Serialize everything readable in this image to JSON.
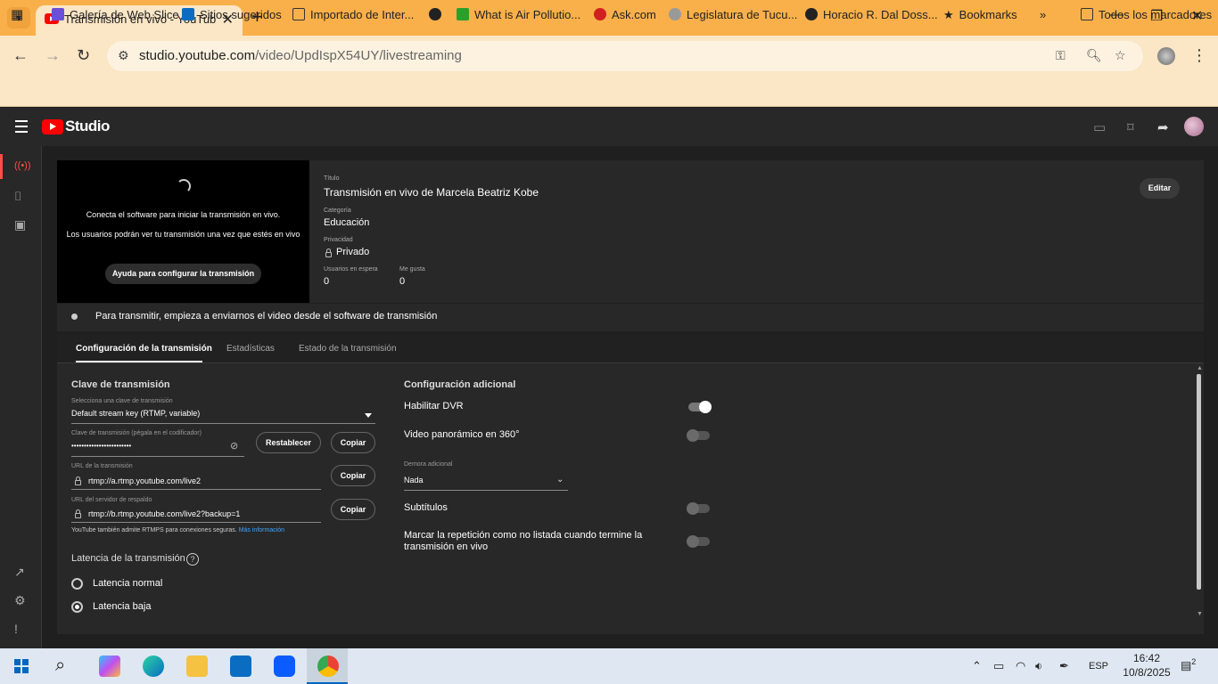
{
  "browser": {
    "tab_title": "Transmisión en vivo - YouTube Studio",
    "url_host": "studio.youtube.com",
    "url_path": "/video/UpdIspX54UY/livestreaming",
    "bookmarks": [
      "Galería de Web Slice",
      "Sitios sugeridos",
      "Importado de Inter...",
      "What is Air Pollutio...",
      "Ask.com",
      "Legislatura de Tucu...",
      "Horacio R. Dal Doss...",
      "Bookmarks",
      "Todos los marcadores"
    ]
  },
  "studio": {
    "logo_text": "Studio"
  },
  "preview": {
    "line1": "Conecta el software para iniciar la transmisión en vivo.",
    "line2": "Los usuarios podrán ver tu transmisión una vez que estés en vivo",
    "help_button": "Ayuda para configurar la transmisión"
  },
  "details": {
    "title_label": "Título",
    "title_value": "Transmisión en vivo de Marcela Beatriz Kobe",
    "category_label": "Categoría",
    "category_value": "Educación",
    "privacy_label": "Privacidad",
    "privacy_value": "Privado",
    "waiting_label": "Usuarios en espera",
    "waiting_value": "0",
    "likes_label": "Me gusta",
    "likes_value": "0",
    "edit_button": "Editar"
  },
  "status_text": "Para transmitir, empieza a enviarnos el video desde el software de transmisión",
  "tabs": [
    "Configuración de la transmisión",
    "Estadísticas",
    "Estado de la transmisión"
  ],
  "stream_key": {
    "section_title": "Clave de transmisión",
    "select_label": "Selecciona una clave de transmisión",
    "select_value": "Default stream key (RTMP, variable)",
    "key_label": "Clave de transmisión (pégala en el codificador)",
    "key_value": "••••••••••••••••••••••••",
    "reset_button": "Restablecer",
    "copy_button": "Copiar",
    "url_label": "URL de la transmisión",
    "url_value": "rtmp://a.rtmp.youtube.com/live2",
    "backup_label": "URL del servidor de respaldo",
    "backup_value": "rtmp://b.rtmp.youtube.com/live2?backup=1",
    "hint": "YouTube también admite RTMPS para conexiones seguras.",
    "hint_link": "Más información"
  },
  "latency": {
    "title": "Latencia de la transmisión",
    "options": [
      "Latencia normal",
      "Latencia baja"
    ],
    "selected": "Latencia baja"
  },
  "additional": {
    "title": "Configuración adicional",
    "dvr_label": "Habilitar DVR",
    "dvr_on": true,
    "pano_label": "Video panorámico en 360°",
    "pano_on": false,
    "delay_label": "Demora adicional",
    "delay_value": "Nada",
    "subs_label": "Subtítulos",
    "subs_on": false,
    "unlisted_label_1": "Marcar la repetición como no listada cuando termine la",
    "unlisted_label_2": "transmisión en vivo",
    "unlisted_on": false
  },
  "taskbar": {
    "lang": "ESP",
    "time": "16:42",
    "date": "10/8/2025",
    "notifications": "2"
  },
  "colors": {
    "tab_bar": "#f9b04a",
    "yt_red": "#ff0000",
    "studio_bg": "#1f1f1f",
    "link": "#3ea6ff"
  }
}
